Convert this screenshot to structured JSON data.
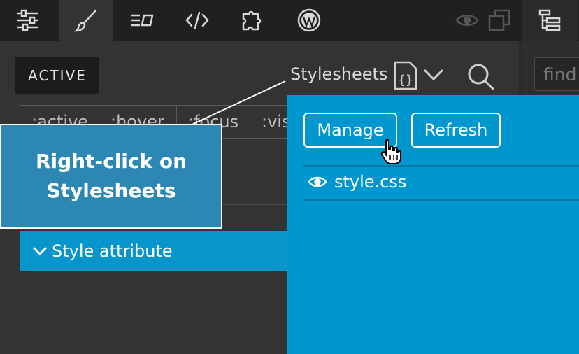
{
  "toolbar": {
    "icons": [
      "sliders-icon",
      "brush-icon",
      "list-box-icon",
      "code-icon",
      "puzzle-icon",
      "wordpress-icon",
      "eye-icon",
      "layers-icon",
      "tree-icon"
    ]
  },
  "panel": {
    "active_tab": "ACTIVE",
    "stylesheets_label": "Stylesheets",
    "pseudo_classes": [
      ":active",
      ":hover",
      ":focus",
      ":vis"
    ],
    "style_attribute": "Style attribute"
  },
  "right_panel": {
    "find_placeholder": "find"
  },
  "dropdown": {
    "manage_label": "Manage",
    "refresh_label": "Refresh",
    "stylesheet_item": "style.css"
  },
  "tooltip": {
    "line1": "Right-click on",
    "line2": "Stylesheets"
  },
  "colors": {
    "accent": "#0097ce",
    "tooltip_bg": "#2c87b2",
    "toolbar_bg": "#202020",
    "panel_bg": "#333333"
  }
}
